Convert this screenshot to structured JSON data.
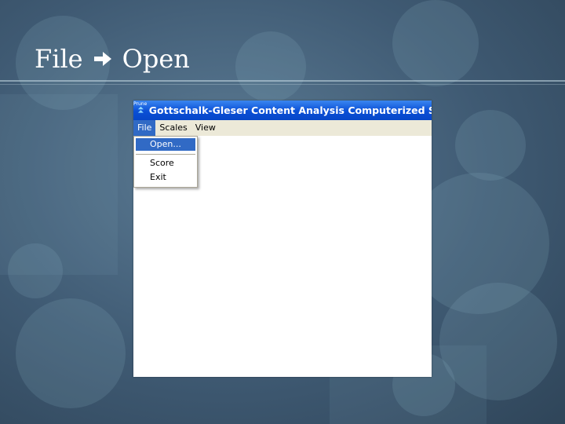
{
  "slide": {
    "title_left": "File",
    "title_right": "Open",
    "arrow_icon": "arrow-right-icon"
  },
  "window": {
    "app_icon_label": "Prune",
    "title": "Gottschalk-Gleser Content Analysis Computerized Scoring"
  },
  "menubar": {
    "items": [
      "File",
      "Scales",
      "View"
    ],
    "active": "File"
  },
  "file_menu": {
    "items": [
      "Open...",
      "Score",
      "Exit"
    ],
    "highlighted": "Open..."
  },
  "colors": {
    "titlebar": "#0a4fd6",
    "menu_highlight": "#316ac5",
    "menubar_bg": "#ece9d8"
  }
}
